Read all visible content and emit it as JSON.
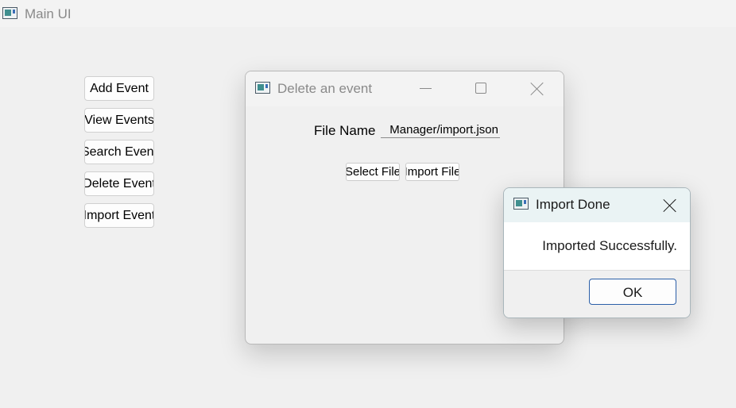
{
  "main_window": {
    "title": "Main UI",
    "buttons": [
      {
        "label": "Add Event"
      },
      {
        "label": "View Events"
      },
      {
        "label": "Search Event"
      },
      {
        "label": "Delete Event"
      },
      {
        "label": "Import Event"
      }
    ]
  },
  "delete_window": {
    "title": "Delete an event",
    "file_name_label": "File Name",
    "file_path": "Manager/import.json",
    "select_file_button": "Select File",
    "import_file_button": "Import File"
  },
  "import_dialog": {
    "title": "Import Done",
    "message": "Imported Successfully.",
    "ok_label": "OK"
  }
}
